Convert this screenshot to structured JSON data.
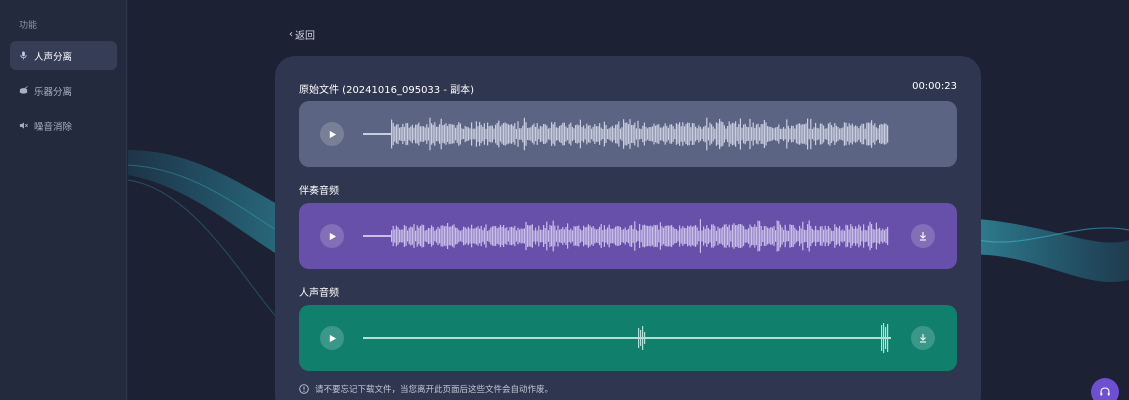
{
  "sidebar": {
    "title": "功能",
    "items": [
      {
        "label": "人声分离",
        "icon": "microphone-icon",
        "active": true
      },
      {
        "label": "乐器分离",
        "icon": "drum-icon",
        "active": false
      },
      {
        "label": "噪音消除",
        "icon": "noise-icon",
        "active": false
      }
    ]
  },
  "header": {
    "back_label": "返回"
  },
  "file": {
    "title": "原始文件 (20241016_095033 - 副本)",
    "duration": "00:00:23"
  },
  "tracks": {
    "accompaniment_label": "伴奏音频",
    "vocal_label": "人声音频"
  },
  "notice": "请不要忘记下载文件，当您离开此页面后这些文件会自动作废。",
  "colors": {
    "original_track": "#5b6482",
    "accompaniment_track": "#6750a9",
    "vocal_track": "#10806d",
    "panel": "#2f3650",
    "accent": "#6d4fd1"
  }
}
